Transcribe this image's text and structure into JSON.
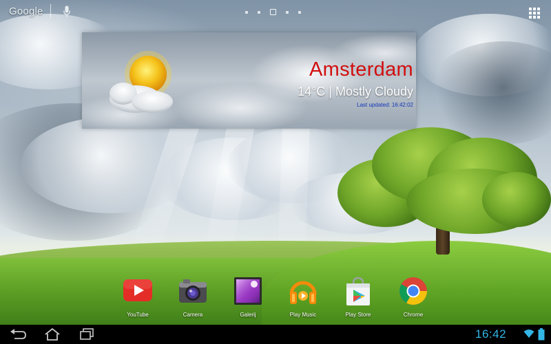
{
  "search": {
    "logo_text": "Google"
  },
  "page_indicator": {
    "count": 5,
    "active_index": 2
  },
  "weather": {
    "city": "Amsterdam",
    "condition": "14°C | Mostly Cloudy",
    "last_updated": "Last updated: 16:42:02",
    "icon": "partly-cloudy-sun-icon",
    "city_color": "#d10f0f",
    "updated_color": "#1336b8"
  },
  "dock": {
    "apps": [
      {
        "label": "YouTube",
        "icon": "youtube-icon"
      },
      {
        "label": "Camera",
        "icon": "camera-icon"
      },
      {
        "label": "Galerij",
        "icon": "gallery-icon"
      },
      {
        "label": "Play Music",
        "icon": "play-music-icon"
      },
      {
        "label": "Play Store",
        "icon": "play-store-icon"
      },
      {
        "label": "Chrome",
        "icon": "chrome-icon"
      }
    ]
  },
  "navbar": {
    "buttons": [
      "back-icon",
      "home-icon",
      "recent-apps-icon"
    ],
    "time": "16:42",
    "accent": "#33b5e5"
  }
}
